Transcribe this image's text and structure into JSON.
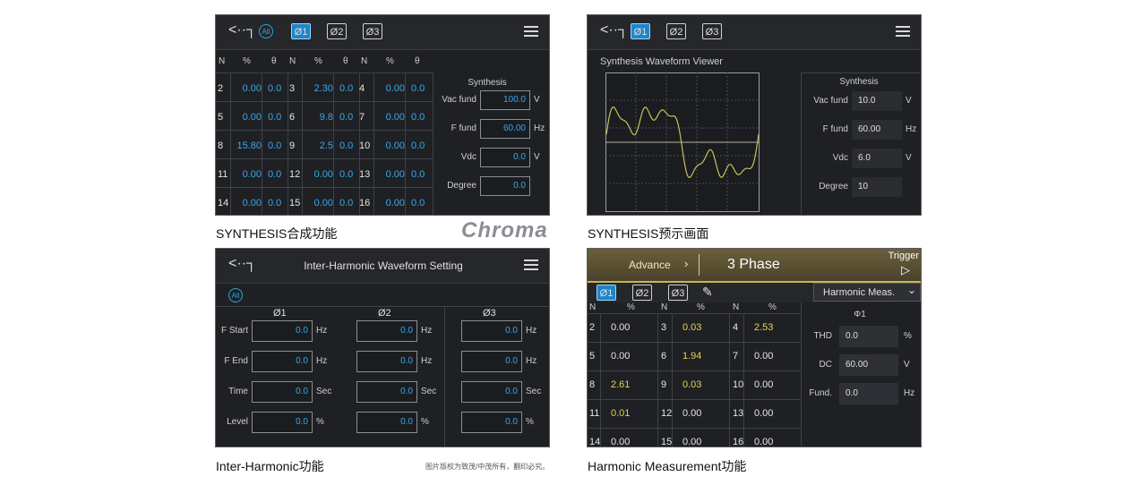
{
  "captions": {
    "p1": "SYNTHESIS合成功能",
    "p2": "SYNTHESIS预示画面",
    "p3": "Inter-Harmonic功能",
    "p4": "Harmonic Measurement功能",
    "brand": "Chroma",
    "notice": "图片版权为致茂/中茂所有，翻印必究。"
  },
  "tabs": {
    "all": "All",
    "phase1": "Ø1",
    "phase2": "Ø2",
    "phase3": "Ø3"
  },
  "p1": {
    "headers": [
      "N",
      "%",
      "θ",
      "N",
      "%",
      "θ",
      "N",
      "%",
      "θ"
    ],
    "rows": [
      [
        "2",
        "0.00",
        "0.0",
        "3",
        "2.30",
        "0.0",
        "4",
        "0.00",
        "0.0"
      ],
      [
        "5",
        "0.00",
        "0.0",
        "6",
        "9.8",
        "0.0",
        "7",
        "0.00",
        "0.0"
      ],
      [
        "8",
        "15.80",
        "0.0",
        "9",
        "2.5",
        "0.0",
        "10",
        "0.00",
        "0.0"
      ],
      [
        "11",
        "0.00",
        "0.0",
        "12",
        "0.00",
        "0.0",
        "13",
        "0.00",
        "0.0"
      ],
      [
        "14",
        "0.00",
        "0.0",
        "15",
        "0.00",
        "0.0",
        "16",
        "0.00",
        "0.0"
      ]
    ],
    "side_title": "Synthesis",
    "fields": [
      {
        "label": "Vac fund",
        "value": "100.0",
        "unit": "V"
      },
      {
        "label": "F fund",
        "value": "60.00",
        "unit": "Hz"
      },
      {
        "label": "Vdc",
        "value": "0.0",
        "unit": "V"
      },
      {
        "label": "Degree",
        "value": "0.0",
        "unit": ""
      }
    ]
  },
  "p2": {
    "title": "Synthesis Waveform Viewer",
    "side_title": "Synthesis",
    "fields": [
      {
        "label": "Vac fund",
        "value": "10.0",
        "unit": "V"
      },
      {
        "label": "F fund",
        "value": "60.00",
        "unit": "Hz"
      },
      {
        "label": "Vdc",
        "value": "6.0",
        "unit": "V"
      },
      {
        "label": "Degree",
        "value": "10",
        "unit": ""
      }
    ]
  },
  "p3": {
    "title": "Inter-Harmonic Waveform Setting",
    "phases": [
      "Ø1",
      "Ø2",
      "Ø3"
    ],
    "rows": [
      {
        "label": "F Start",
        "value": "0.0",
        "unit": "Hz"
      },
      {
        "label": "F End",
        "value": "0.0",
        "unit": "Hz"
      },
      {
        "label": "Time",
        "value": "0.0",
        "unit": "Sec"
      },
      {
        "label": "Level",
        "value": "0.0",
        "unit": "%"
      }
    ]
  },
  "p4": {
    "advance": "Advance",
    "advance_arrow": "›",
    "mode": "3 Phase",
    "trigger": "Trigger",
    "trigger_icon": "▷",
    "dropdown": "Harmonic Meas.",
    "dropdown_arrow": "⌄",
    "headers": [
      "N",
      "%",
      "N",
      "%",
      "N",
      "%"
    ],
    "rows": [
      [
        {
          "n": "2",
          "v": "0.00",
          "c": "w"
        },
        {
          "n": "3",
          "v": "0.03",
          "c": "y"
        },
        {
          "n": "4",
          "v": "2.53",
          "c": "y"
        }
      ],
      [
        {
          "n": "5",
          "v": "0.00",
          "c": "w"
        },
        {
          "n": "6",
          "v": "1.94",
          "c": "y"
        },
        {
          "n": "7",
          "v": "0.00",
          "c": "w"
        }
      ],
      [
        {
          "n": "8",
          "v": "2.61",
          "c": "y"
        },
        {
          "n": "9",
          "v": "0.03",
          "c": "y"
        },
        {
          "n": "10",
          "v": "0.00",
          "c": "w"
        }
      ],
      [
        {
          "n": "11",
          "v": "0.01",
          "c": "y"
        },
        {
          "n": "12",
          "v": "0.00",
          "c": "w"
        },
        {
          "n": "13",
          "v": "0.00",
          "c": "w"
        }
      ],
      [
        {
          "n": "14",
          "v": "0.00",
          "c": "w"
        },
        {
          "n": "15",
          "v": "0.00",
          "c": "w"
        },
        {
          "n": "16",
          "v": "0.00",
          "c": "w"
        }
      ]
    ],
    "side_title": "Φ1",
    "fields": [
      {
        "label": "THD",
        "value": "0.0",
        "unit": "%"
      },
      {
        "label": "DC",
        "value": "60.00",
        "unit": "V"
      },
      {
        "label": "Fund.",
        "value": "0.0",
        "unit": "Hz"
      }
    ]
  },
  "colors": {
    "accent": "#1e86c8",
    "value_blue": "#3aa8e8",
    "value_yellow": "#e8d24a",
    "panel_bg": "#1e2024",
    "gold_bar": "#6b5f3a"
  }
}
